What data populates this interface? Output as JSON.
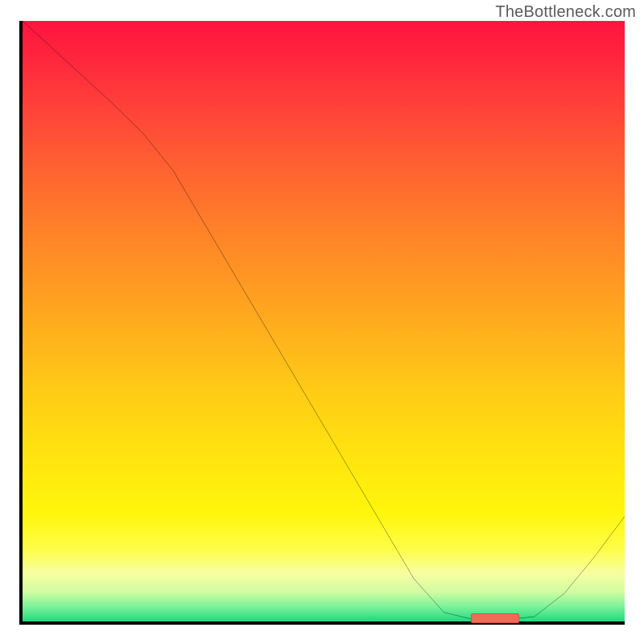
{
  "attribution": "TheBottleneck.com",
  "chart_data": {
    "type": "line",
    "title": "",
    "xlabel": "",
    "ylabel": "",
    "xlim": [
      0,
      100
    ],
    "ylim": [
      0,
      100
    ],
    "series": [
      {
        "name": "curve",
        "x": [
          0,
          5,
          10,
          15,
          20,
          25,
          30,
          35,
          40,
          45,
          50,
          55,
          60,
          65,
          70,
          75,
          80,
          85,
          90,
          95,
          100
        ],
        "y": [
          100,
          95.4,
          90.8,
          86.2,
          81.3,
          75.1,
          66.6,
          58.1,
          49.6,
          41.1,
          32.6,
          24.1,
          15.6,
          7.1,
          1.5,
          0.3,
          0.3,
          0.8,
          4.7,
          10.8,
          17.5
        ]
      }
    ],
    "marker": {
      "x": 78.5,
      "y": 0.5
    },
    "colors": {
      "curve": "#000000",
      "marker": "#ef6b58",
      "axes": "#000000",
      "gradient_top": "#ff133e",
      "gradient_bottom": "#1fd97e"
    }
  }
}
